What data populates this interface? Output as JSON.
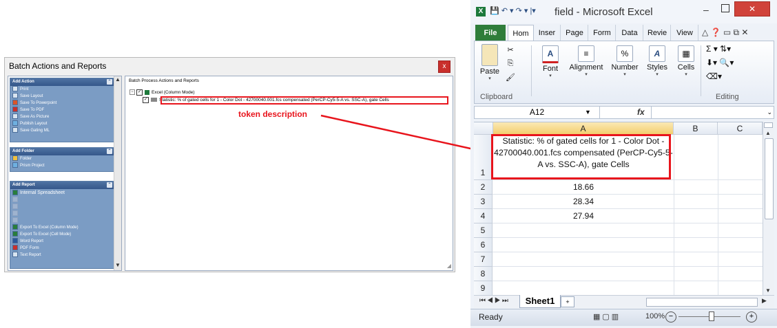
{
  "batch": {
    "title": "Batch Actions and Reports",
    "close_label": "x",
    "right_header": "Batch Process Actions and Reports",
    "groups": [
      {
        "title": "Add Action",
        "items": [
          "Print",
          "Save Layout",
          "Save To Powerpoint",
          "Save To PDF",
          "Save As Picture",
          "Publish Layout",
          "Save Gating ML"
        ]
      },
      {
        "title": "Add Folder",
        "items": [
          "Folder",
          "Prism Project"
        ]
      },
      {
        "title": "Add Report",
        "items": [
          "Internal Spreadsheet",
          "Export To Excel (Column Mode)",
          "Export To Excel (Cell Mode)",
          "Word Report",
          "PDF Form",
          "Text Report"
        ]
      }
    ],
    "tree": {
      "root": "Excel (Column Mode)",
      "child": "Statistic: % of gated cells for 1 - Color Dot - 42700040.001.fcs compensated (PerCP-Cy5-5-A vs. SSC-A), gate Cells"
    }
  },
  "annotation": {
    "label": "token description"
  },
  "excel": {
    "title": "field  -  Microsoft Excel",
    "tabs": [
      "File",
      "Hom",
      "Inser",
      "Page",
      "Form",
      "Data",
      "Revie",
      "View"
    ],
    "ribbon": {
      "paste": "Paste",
      "font": "Font",
      "alignment": "Alignment",
      "number": "Number",
      "styles": "Styles",
      "cells": "Cells",
      "clipboard": "Clipboard",
      "editing": "Editing"
    },
    "name_box": "A12",
    "fx": "fx",
    "columns": [
      "A",
      "B",
      "C"
    ],
    "rows": [
      "1",
      "2",
      "3",
      "4",
      "5",
      "6",
      "7",
      "8",
      "9"
    ],
    "cells": {
      "A1": "Statistic: % of gated cells for 1 - Color Dot - 42700040.001.fcs compensated (PerCP-Cy5-5-A vs. SSC-A), gate Cells",
      "A2": "18.66",
      "A3": "28.34",
      "A4": "27.94"
    },
    "sheet_tab": "Sheet1",
    "status": "Ready",
    "zoom": "100%"
  }
}
